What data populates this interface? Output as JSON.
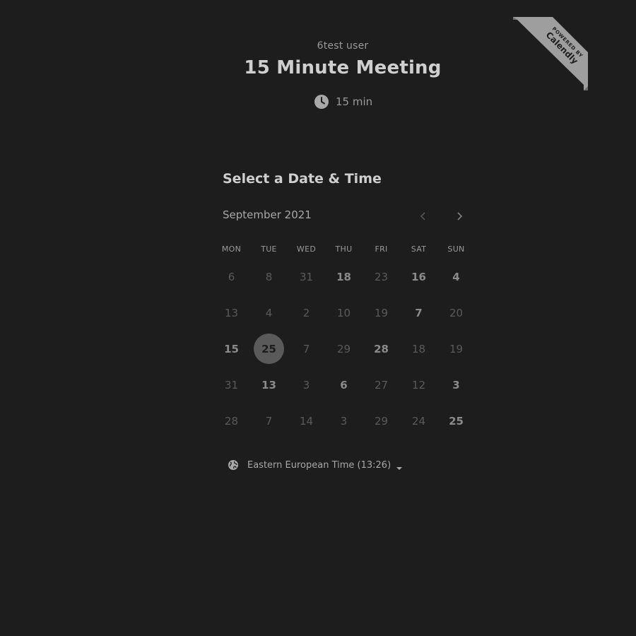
{
  "header": {
    "host_name": "6test user",
    "event_title": "15 Minute Meeting",
    "duration": "15 min",
    "duration_icon": "clock-icon"
  },
  "badge": {
    "small_text": "POWERED BY",
    "brand": "Calendly",
    "color": "#9e9e9e"
  },
  "picker": {
    "title": "Select a Date & Time",
    "month": "September 2021",
    "prev_icon": "chevron-left-icon",
    "next_icon": "chevron-right-icon",
    "weekdays": [
      "MON",
      "TUE",
      "WED",
      "THU",
      "FRI",
      "SAT",
      "SUN"
    ],
    "weeks": [
      [
        {
          "label": "6",
          "available": false
        },
        {
          "label": "8",
          "available": false
        },
        {
          "label": "31",
          "available": false
        },
        {
          "label": "18",
          "available": true
        },
        {
          "label": "23",
          "available": false
        },
        {
          "label": "16",
          "available": true
        },
        {
          "label": "4",
          "available": true
        }
      ],
      [
        {
          "label": "13",
          "available": false
        },
        {
          "label": "4",
          "available": false
        },
        {
          "label": "2",
          "available": false
        },
        {
          "label": "10",
          "available": false
        },
        {
          "label": "19",
          "available": false
        },
        {
          "label": "7",
          "available": true
        },
        {
          "label": "20",
          "available": false
        }
      ],
      [
        {
          "label": "15",
          "available": true
        },
        {
          "label": "25",
          "available": true,
          "selected": true
        },
        {
          "label": "7",
          "available": false
        },
        {
          "label": "29",
          "available": false
        },
        {
          "label": "28",
          "available": true
        },
        {
          "label": "18",
          "available": false
        },
        {
          "label": "19",
          "available": false
        }
      ],
      [
        {
          "label": "31",
          "available": false
        },
        {
          "label": "13",
          "available": true
        },
        {
          "label": "3",
          "available": false
        },
        {
          "label": "6",
          "available": true
        },
        {
          "label": "27",
          "available": false
        },
        {
          "label": "12",
          "available": false
        },
        {
          "label": "3",
          "available": true
        }
      ],
      [
        {
          "label": "28",
          "available": false
        },
        {
          "label": "7",
          "available": false
        },
        {
          "label": "14",
          "available": false
        },
        {
          "label": "3",
          "available": false
        },
        {
          "label": "29",
          "available": false
        },
        {
          "label": "24",
          "available": false
        },
        {
          "label": "25",
          "available": true
        }
      ]
    ]
  },
  "timezone": {
    "label": "Eastern European Time (13:26)",
    "icon": "globe-icon"
  },
  "colors": {
    "background": "#1d1d1d",
    "selected_day": "#5a5a5a",
    "text_muted": "#5a5a5a",
    "text_available": "#8a8a8a"
  }
}
